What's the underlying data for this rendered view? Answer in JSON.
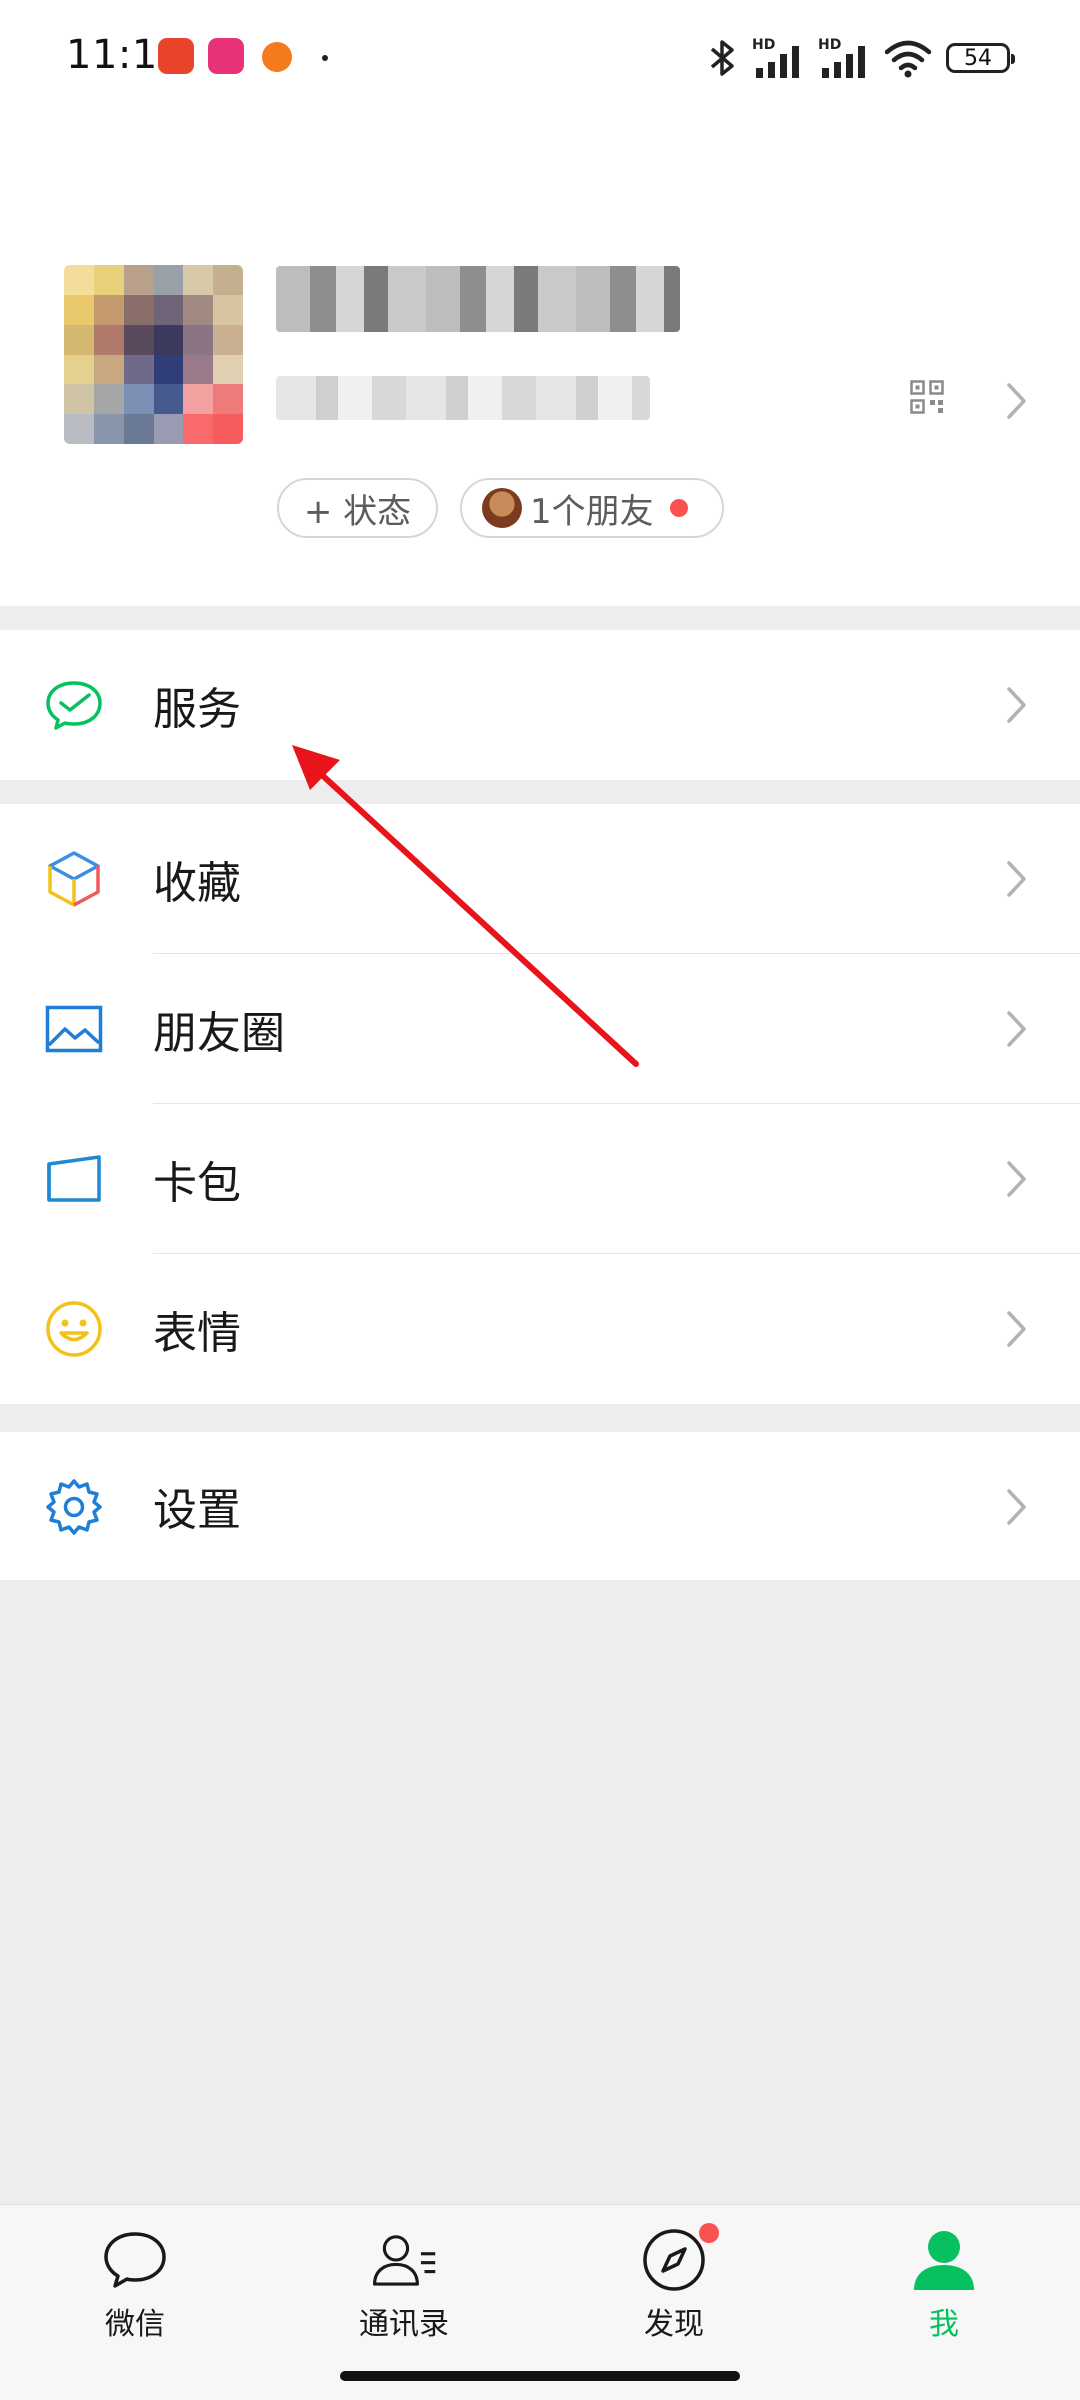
{
  "status_bar": {
    "time": "11:16",
    "battery": "54",
    "hd1": "HD",
    "hd2": "HD"
  },
  "profile": {
    "status_button": "+ 状态",
    "friends_button": "1个朋友"
  },
  "menu": {
    "groups": [
      {
        "items": [
          {
            "label": "服务",
            "icon": "wechat-pay-check-icon",
            "color": "#07c160"
          }
        ]
      },
      {
        "items": [
          {
            "label": "收藏",
            "icon": "cube-favorites-icon"
          },
          {
            "label": "朋友圈",
            "icon": "moments-picture-icon",
            "color": "#1e7fd6"
          },
          {
            "label": "卡包",
            "icon": "card-wallet-icon",
            "color": "#1f8ad1"
          },
          {
            "label": "表情",
            "icon": "smiley-sticker-icon",
            "color": "#f2c21b"
          }
        ]
      },
      {
        "items": [
          {
            "label": "设置",
            "icon": "gear-icon",
            "color": "#1e7fd6"
          }
        ]
      }
    ]
  },
  "tabbar": {
    "tabs": [
      {
        "label": "微信",
        "icon": "chat-bubble-icon",
        "active": false
      },
      {
        "label": "通讯录",
        "icon": "contacts-icon",
        "active": false
      },
      {
        "label": "发现",
        "icon": "compass-icon",
        "active": false,
        "badge": true
      },
      {
        "label": "我",
        "icon": "person-icon",
        "active": true
      }
    ]
  },
  "colors": {
    "accent": "#07c160",
    "badge": "#fa5151",
    "arrow": "#e8141c"
  }
}
